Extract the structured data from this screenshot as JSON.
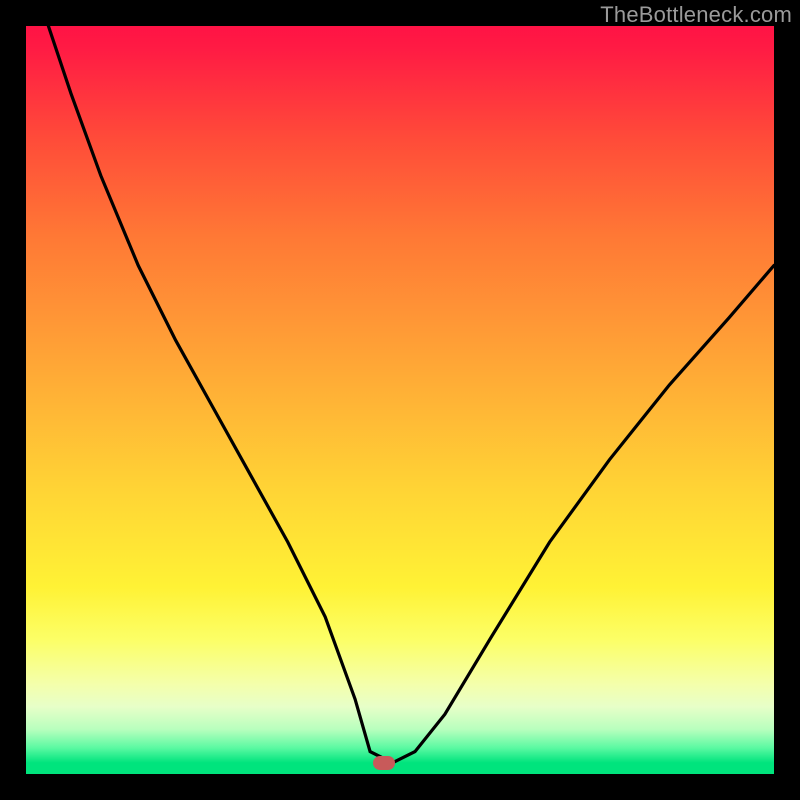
{
  "watermark": "TheBottleneck.com",
  "marker": {
    "color": "#c85a5a",
    "x_fraction": 0.478,
    "y_fraction": 0.985
  },
  "chart_data": {
    "type": "line",
    "title": "",
    "xlabel": "",
    "ylabel": "",
    "xlim": [
      0,
      1
    ],
    "ylim": [
      0,
      1
    ],
    "series": [
      {
        "name": "bottleneck-curve",
        "x": [
          0.03,
          0.06,
          0.1,
          0.15,
          0.2,
          0.25,
          0.3,
          0.35,
          0.4,
          0.44,
          0.46,
          0.49,
          0.52,
          0.56,
          0.62,
          0.7,
          0.78,
          0.86,
          0.94,
          1.0
        ],
        "y": [
          1.0,
          0.91,
          0.8,
          0.68,
          0.58,
          0.49,
          0.4,
          0.31,
          0.21,
          0.1,
          0.03,
          0.015,
          0.03,
          0.08,
          0.18,
          0.31,
          0.42,
          0.52,
          0.61,
          0.68
        ]
      }
    ],
    "annotations": [],
    "grid": false,
    "legend": false,
    "background_gradient": {
      "direction": "vertical",
      "stops": [
        {
          "pos": 0.0,
          "color": "#ff1345"
        },
        {
          "pos": 0.15,
          "color": "#ff4b39"
        },
        {
          "pos": 0.45,
          "color": "#ffa636"
        },
        {
          "pos": 0.75,
          "color": "#fff235"
        },
        {
          "pos": 0.9,
          "color": "#e7ffc8"
        },
        {
          "pos": 1.0,
          "color": "#00e47d"
        }
      ]
    },
    "marker_point": {
      "x": 0.478,
      "y": 0.015,
      "color": "#c85a5a"
    }
  }
}
